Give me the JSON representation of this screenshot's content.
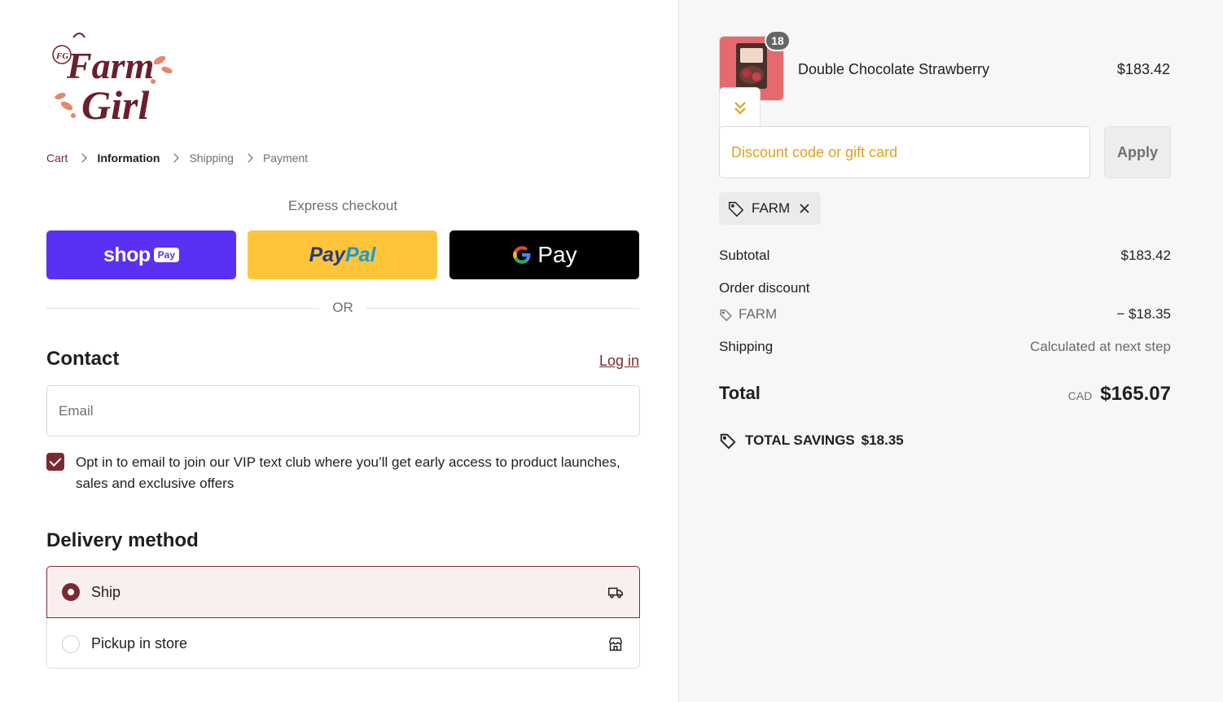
{
  "brand": {
    "name_line1": "Farm",
    "name_line2": "Girl",
    "monogram": "FG",
    "accent": "#7a2a33",
    "logo_color": "#6a1f2a"
  },
  "breadcrumb": {
    "cart": "Cart",
    "information": "Information",
    "shipping": "Shipping",
    "payment": "Payment"
  },
  "express": {
    "label": "Express checkout",
    "shop_word": "shop",
    "shop_pay": "Pay",
    "paypal_1": "Pay",
    "paypal_2": "Pal",
    "gpay_word": "Pay",
    "or": "OR"
  },
  "contact": {
    "title": "Contact",
    "login": "Log in",
    "email_placeholder": "Email",
    "optin_checked": true,
    "optin_text": "Opt in to email to join our VIP text club where you’ll get early access to product launches, sales and exclusive offers"
  },
  "delivery": {
    "title": "Delivery method",
    "options": [
      {
        "label": "Ship",
        "selected": true,
        "icon": "truck-icon"
      },
      {
        "label": "Pickup in store",
        "selected": false,
        "icon": "store-icon"
      }
    ]
  },
  "order": {
    "product": {
      "name": "Double Chocolate Strawberry",
      "price": "$183.42",
      "quantity": "18"
    },
    "discount_placeholder": "Discount code or gift card",
    "apply": "Apply",
    "applied_code": "FARM",
    "subtotal_label": "Subtotal",
    "subtotal_value": "$183.42",
    "order_discount_label": "Order discount",
    "discount_code": "FARM",
    "discount_value": "− $18.35",
    "shipping_label": "Shipping",
    "shipping_value": "Calculated at next step",
    "total_label": "Total",
    "currency": "CAD",
    "total_value": "$165.07",
    "savings_label": "TOTAL SAVINGS",
    "savings_value": "$18.35"
  }
}
